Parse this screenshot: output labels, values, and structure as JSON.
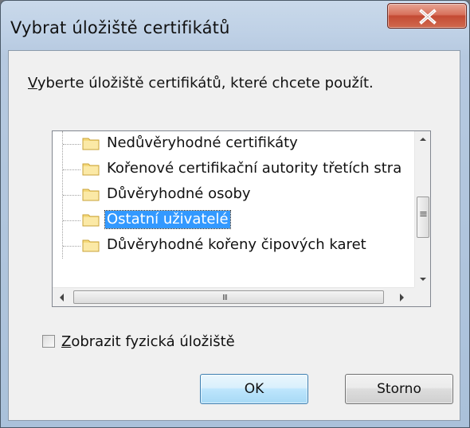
{
  "window": {
    "title": "Vybrat úložiště certifikátů",
    "close_glyph": "x"
  },
  "prompt": {
    "underlined": "V",
    "rest": "yberte úložiště certifikátů, které chcete použít."
  },
  "tree": {
    "items": [
      {
        "label": "Nedůvěryhodné certifikáty",
        "icon": "folder-icon",
        "selected": false
      },
      {
        "label": "Kořenové certifikační autority třetích stra",
        "icon": "folder-icon",
        "selected": false
      },
      {
        "label": "Důvěryhodné osoby",
        "icon": "folder-icon",
        "selected": false
      },
      {
        "label": "Ostatní uživatelé",
        "icon": "folder-icon",
        "selected": true
      },
      {
        "label": "Důvěryhodné kořeny čipových karet",
        "icon": "folder-icon",
        "selected": false
      }
    ],
    "hscroll_grip": "III",
    "vscroll_grip": "≡"
  },
  "checkbox": {
    "underlined": "Z",
    "rest": "obrazit fyzická úložiště",
    "checked": false
  },
  "buttons": {
    "ok_label": "OK",
    "cancel_label": "Storno"
  },
  "colors": {
    "selection": "#3399ff",
    "close_button": "#c44a33",
    "default_button_border": "#3c7fb1"
  }
}
